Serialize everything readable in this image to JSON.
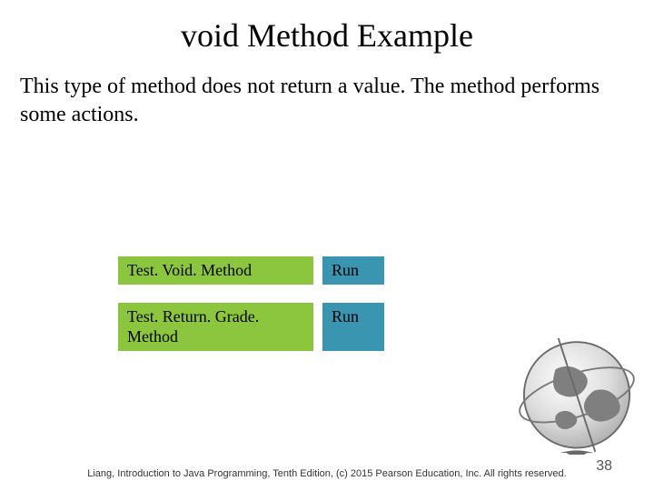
{
  "title": "void Method Example",
  "body": "This type of method does not return a value. The method performs some actions.",
  "buttons": [
    {
      "label": "Test. Void. Method",
      "action": "Run"
    },
    {
      "label": "Test. Return. Grade. Method",
      "action": "Run"
    }
  ],
  "footer": "Liang, Introduction to Java Programming, Tenth Edition, (c) 2015 Pearson Education, Inc. All rights reserved.",
  "page_number": "38"
}
